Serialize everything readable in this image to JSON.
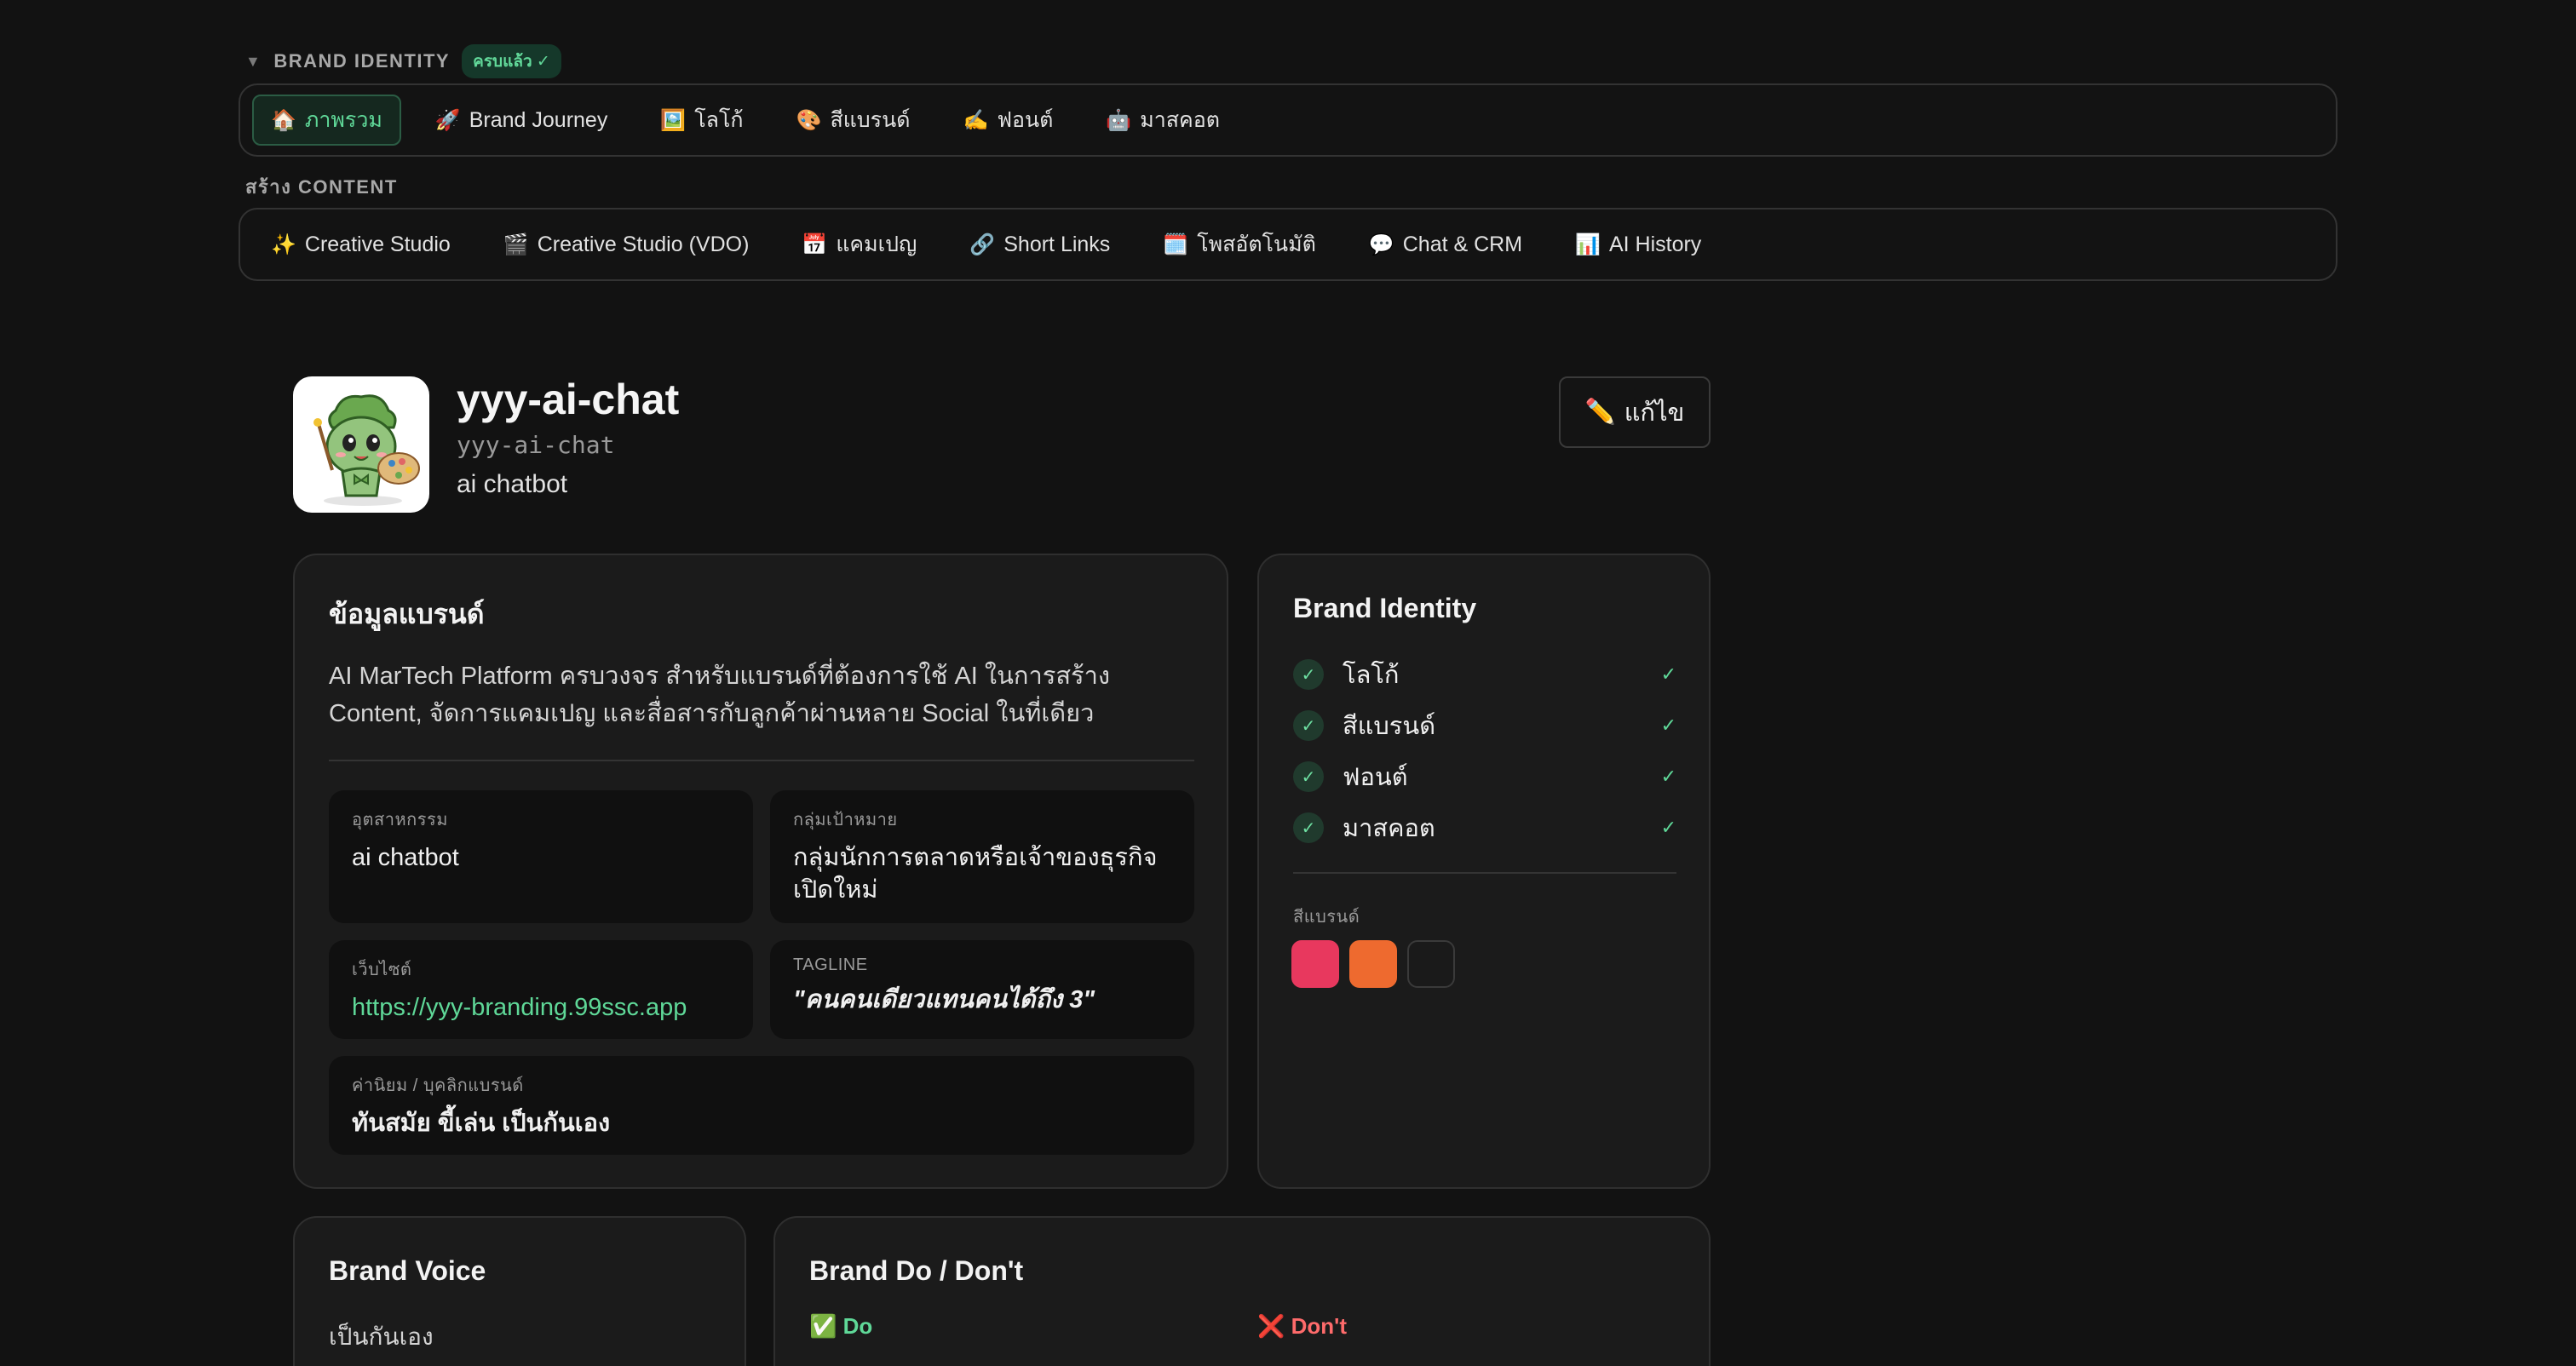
{
  "brand_identity_section": {
    "title": "BRAND IDENTITY",
    "status_badge": "ครบแล้ว ✓",
    "tabs": [
      {
        "icon": "🏠",
        "label": "ภาพรวม",
        "active": true
      },
      {
        "icon": "🚀",
        "label": "Brand Journey"
      },
      {
        "icon": "🖼️",
        "label": "โลโก้"
      },
      {
        "icon": "🎨",
        "label": "สีแบรนด์"
      },
      {
        "icon": "✍️",
        "label": "ฟอนต์"
      },
      {
        "icon": "🤖",
        "label": "มาสคอต"
      }
    ]
  },
  "content_section": {
    "title": "สร้าง CONTENT",
    "tabs": [
      {
        "icon": "✨",
        "label": "Creative Studio"
      },
      {
        "icon": "🎬",
        "label": "Creative Studio (VDO)"
      },
      {
        "icon": "📅",
        "label": "แคมเปญ"
      },
      {
        "icon": "🔗",
        "label": "Short Links"
      },
      {
        "icon": "🗓️",
        "label": "โพสอัตโนมัติ"
      },
      {
        "icon": "💬",
        "label": "Chat & CRM"
      },
      {
        "icon": "📊",
        "label": "AI History"
      }
    ]
  },
  "brand": {
    "name": "yyy-ai-chat",
    "slug": "yyy-ai-chat",
    "description": "ai chatbot",
    "edit_label": "แก้ไข",
    "edit_icon": "✏️"
  },
  "info_card": {
    "title": "ข้อมูลแบรนด์",
    "description": "AI MarTech Platform ครบวงจร สำหรับแบรนด์ที่ต้องการใช้ AI ในการสร้าง Content, จัดการแคมเปญ และสื่อสารกับลูกค้าผ่านหลาย Social ในที่เดียว",
    "fields": {
      "industry": {
        "label": "อุตสาหกรรม",
        "value": "ai chatbot"
      },
      "target": {
        "label": "กลุ่มเป้าหมาย",
        "value": "กลุ่มนักการตลาดหรือเจ้าของธุรกิจเปิดใหม่"
      },
      "website": {
        "label": "เว็บไซต์",
        "value": "https://yyy-branding.99ssc.app"
      },
      "tagline": {
        "label": "TAGLINE",
        "value": "\"คนคนเดียวแทนคนได้ถึง 3\""
      },
      "values": {
        "label": "ค่านิยม / บุคลิกแบรนด์",
        "value": "ทันสมัย ขี้เล่น เป็นกันเอง"
      }
    }
  },
  "identity_card": {
    "title": "Brand Identity",
    "items": [
      {
        "label": "โลโก้",
        "tick": "✓"
      },
      {
        "label": "สีแบรนด์",
        "tick": "✓"
      },
      {
        "label": "ฟอนต์",
        "tick": "✓"
      },
      {
        "label": "มาสคอต",
        "tick": "✓"
      }
    ],
    "colors_label": "สีแบรนด์",
    "colors": [
      "#e8385e",
      "#ee6a2f",
      "#1a1a1a"
    ]
  },
  "voice_card": {
    "title": "Brand Voice",
    "value": "เป็นกันเอง"
  },
  "dodont_card": {
    "title": "Brand Do / Don't",
    "do_label": "✅ Do",
    "dont_label": "❌ Don't"
  }
}
